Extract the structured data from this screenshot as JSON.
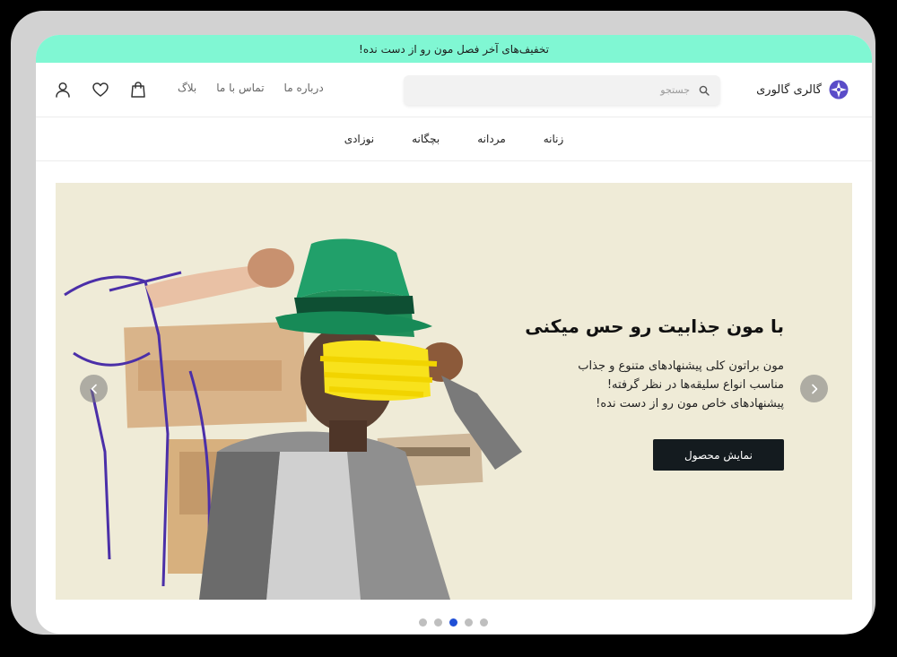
{
  "promo_banner": {
    "text": "تخفیف‌های آخر فصل مون رو از دست نده!"
  },
  "header": {
    "brand_name": "گالری گالوری",
    "search": {
      "placeholder": "جستجو"
    },
    "links": [
      {
        "label": "درباره ما"
      },
      {
        "label": "تماس با ما"
      },
      {
        "label": "بلاگ"
      }
    ],
    "icons": [
      "cart-icon",
      "heart-icon",
      "user-icon"
    ]
  },
  "category_nav": {
    "items": [
      {
        "label": "زنانه"
      },
      {
        "label": "مردانه"
      },
      {
        "label": "بچگانه"
      },
      {
        "label": "نوزادی"
      }
    ]
  },
  "hero": {
    "title": "با مون جذابیت رو حس میکنی",
    "description_lines": [
      "مون براتون کلی پیشنهادهای متنوع و جذاب",
      "مناسب انواع سلیقه‌ها در نظر گرفته!",
      "پیشنهادهای خاص مون رو از دست نده!"
    ],
    "cta_label": "نمایش محصول",
    "background_color": "#efebd7"
  },
  "carousel": {
    "slide_count": 5,
    "active_index": 2
  },
  "colors": {
    "promo": "#80f7d3",
    "cta": "#141b1f",
    "active_dot": "#1f4fd6",
    "logo": "#5a4cc8"
  }
}
